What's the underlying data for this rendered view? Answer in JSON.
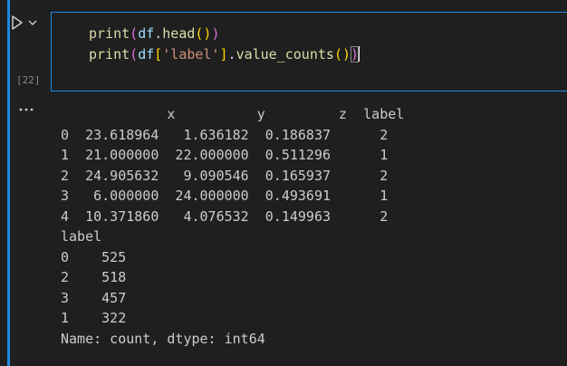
{
  "cell": {
    "execution_count": "[22]",
    "code_lines": [
      {
        "tokens": [
          {
            "text": "print",
            "cls": "tk-fn"
          },
          {
            "text": "(",
            "cls": "tk-br1"
          },
          {
            "text": "df",
            "cls": "tk-var"
          },
          {
            "text": ".",
            "cls": "tk-plain"
          },
          {
            "text": "head",
            "cls": "tk-fn"
          },
          {
            "text": "()",
            "cls": "tk-br2"
          },
          {
            "text": ")",
            "cls": "tk-br1"
          }
        ]
      },
      {
        "tokens": [
          {
            "text": "print",
            "cls": "tk-fn"
          },
          {
            "text": "(",
            "cls": "tk-br1"
          },
          {
            "text": "df",
            "cls": "tk-var"
          },
          {
            "text": "[",
            "cls": "tk-br2"
          },
          {
            "text": "'label'",
            "cls": "tk-str"
          },
          {
            "text": "]",
            "cls": "tk-br2"
          },
          {
            "text": ".",
            "cls": "tk-plain"
          },
          {
            "text": "value_counts",
            "cls": "tk-fn"
          },
          {
            "text": "()",
            "cls": "tk-br2"
          },
          {
            "text": ")",
            "cls": "tk-br1",
            "match": true
          }
        ]
      }
    ]
  },
  "output": {
    "menu_icon": "more-horizontal-icon",
    "lines": [
      "             x          y         z  label",
      "0  23.618964   1.636182  0.186837      2",
      "1  21.000000  22.000000  0.511296      1",
      "2  24.905632   9.090546  0.165937      2",
      "3   6.000000  24.000000  0.493691      1",
      "4  10.371860   4.076532  0.149963      2",
      "label",
      "0    525",
      "2    518",
      "3    457",
      "1    322",
      "Name: count, dtype: int64"
    ]
  },
  "icons": {
    "run": "run-cell-icon",
    "chevron": "chevron-down-icon"
  },
  "colors": {
    "accent": "#1e88e5",
    "background": "#1f1f1f",
    "text": "#cccccc"
  }
}
